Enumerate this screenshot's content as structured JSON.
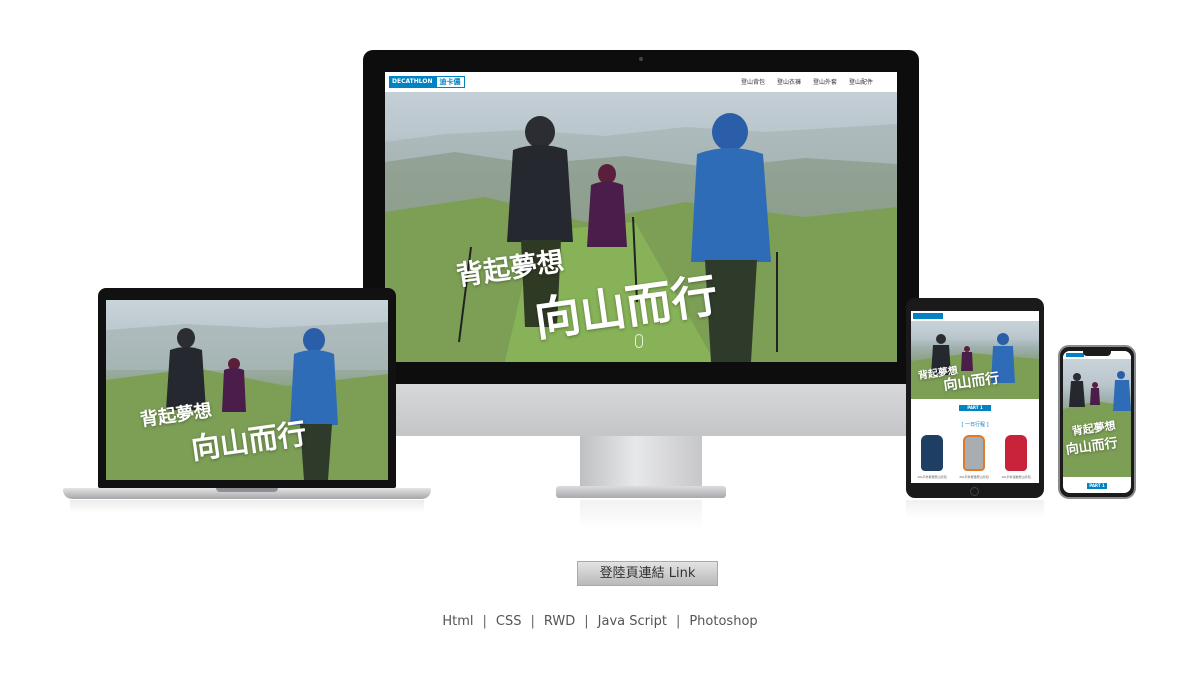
{
  "site": {
    "logo_brand": "DECATHLON",
    "logo_cn": "迪卡儂",
    "nav": [
      "登山背包",
      "登山衣褲",
      "登山外套",
      "登山配件"
    ],
    "slogan_line1": "背起夢想",
    "slogan_line2": "向山而行",
    "part_label": "PART 1",
    "section_sub": "[ 一日行程 ]",
    "products": [
      "10L戶外輕量登山背包",
      "20L戶外輕量登山背包",
      "10L戶外運動登山背包"
    ]
  },
  "caption": {
    "link_button": "登陸頁連結  Link",
    "tech": [
      "Html",
      "CSS",
      "RWD",
      "Java Script",
      "Photoshop"
    ],
    "separator": "|"
  },
  "colors": {
    "brand_blue": "#0082c3",
    "grass": "#7ea452",
    "sky": "#c9d3da",
    "device_black": "#0d0d0d"
  },
  "icons": {
    "scroll": "mouse-scroll-icon"
  }
}
